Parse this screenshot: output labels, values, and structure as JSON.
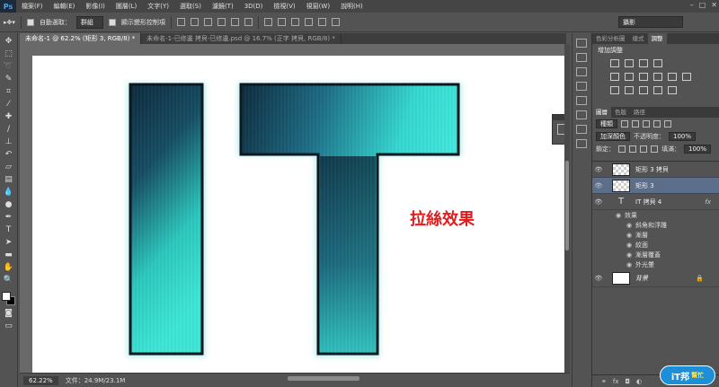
{
  "app": {
    "logo": "Ps"
  },
  "menu": [
    "檔案(F)",
    "編輯(E)",
    "影像(I)",
    "圖層(L)",
    "文字(Y)",
    "選取(S)",
    "濾鏡(T)",
    "3D(D)",
    "檢視(V)",
    "視窗(W)",
    "說明(H)"
  ],
  "options_bar": {
    "auto_select_label": "自動選取：",
    "auto_select_value": "群組",
    "transform_controls_label": "顯示變形控制項"
  },
  "workspace": "攝影",
  "tabs": [
    {
      "label": "未命名-1 @ 62.2% (矩形 3, RGB/8) *",
      "active": true
    },
    {
      "label": "未命名-1-已修邊 拷貝-已修邊.psd @ 16.7% (正字 拷貝, RGB/8) *",
      "active": false
    }
  ],
  "canvas": {
    "caption": "拉絲效果"
  },
  "status": {
    "zoom": "62.22%",
    "doc_size": "文件：24.9M/23.1M"
  },
  "adjustments": {
    "tabs": [
      "色彩分析圖",
      "樣式",
      "調整"
    ],
    "title": "增加調整"
  },
  "layers_panel": {
    "tabs": [
      "圖層",
      "色版",
      "路徑"
    ],
    "kind_filter": "種類",
    "blend_mode": "加深顏色",
    "opacity_label": "不透明度：",
    "opacity_value": "100%",
    "lock_label": "鎖定：",
    "fill_label": "填滿：",
    "fill_value": "100%",
    "layers": [
      {
        "name": "矩形 3 拷貝",
        "selected": false,
        "kind": "shape"
      },
      {
        "name": "矩形 3",
        "selected": true,
        "kind": "shape"
      },
      {
        "name": "IT 拷貝 4",
        "selected": false,
        "kind": "text",
        "fx": "fx"
      },
      {
        "name": "背景",
        "selected": false,
        "kind": "background"
      }
    ],
    "effects_label": "效果",
    "effects": [
      "斜角和浮雕",
      "漸層",
      "紋面",
      "漸層覆蓋",
      "外光暈"
    ]
  },
  "watermark": {
    "text": "iT邦",
    "sub": "幫忙"
  },
  "colors": {
    "teal_light": "#3de6d6",
    "teal_dark": "#0e2a3d",
    "caption_red": "#e21c1c",
    "selected_layer": "#5d6e8a"
  }
}
